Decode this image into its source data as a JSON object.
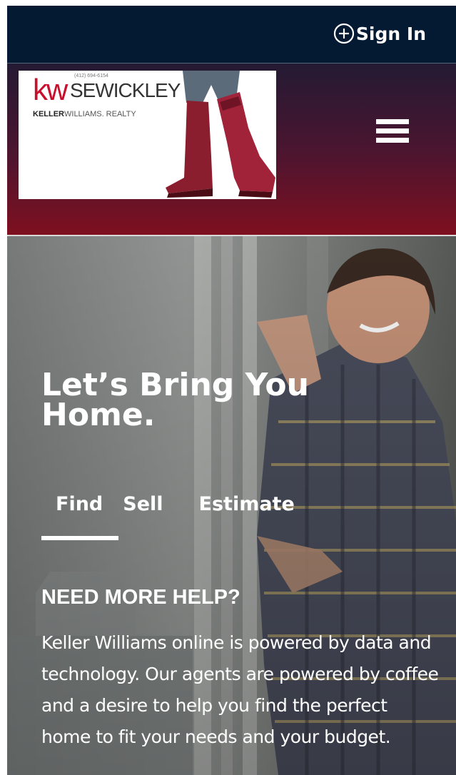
{
  "topbar": {
    "signin_label": "Sign In",
    "signin_icon": "plus-circle-icon"
  },
  "header": {
    "logo": {
      "kw_mark": "kw",
      "brand": "SEWICKLEY",
      "phone": "(412) 694-6154",
      "company_strong": "KELLER",
      "company_rest": "WILLIAMS. REALTY"
    },
    "menu_icon": "hamburger-menu-icon"
  },
  "hero": {
    "headline_line1": "Let’s Bring You",
    "headline_line2": "Home.",
    "tabs": [
      {
        "label": "Find",
        "active": true
      },
      {
        "label": "Sell",
        "active": false
      },
      {
        "label": "Estimate",
        "active": false
      }
    ],
    "help_title": "NEED MORE HELP?",
    "help_text": "Keller Williams online is powered by data and technology. Our agents are powered by coffee and a desire to help you find the perfect home to fit your needs and your budget."
  },
  "colors": {
    "topbar_bg": "#041a33",
    "header_gradient_top": "#241a33",
    "header_gradient_bottom": "#7e1020",
    "brand_red": "#c8102e",
    "text_white": "#ffffff"
  }
}
